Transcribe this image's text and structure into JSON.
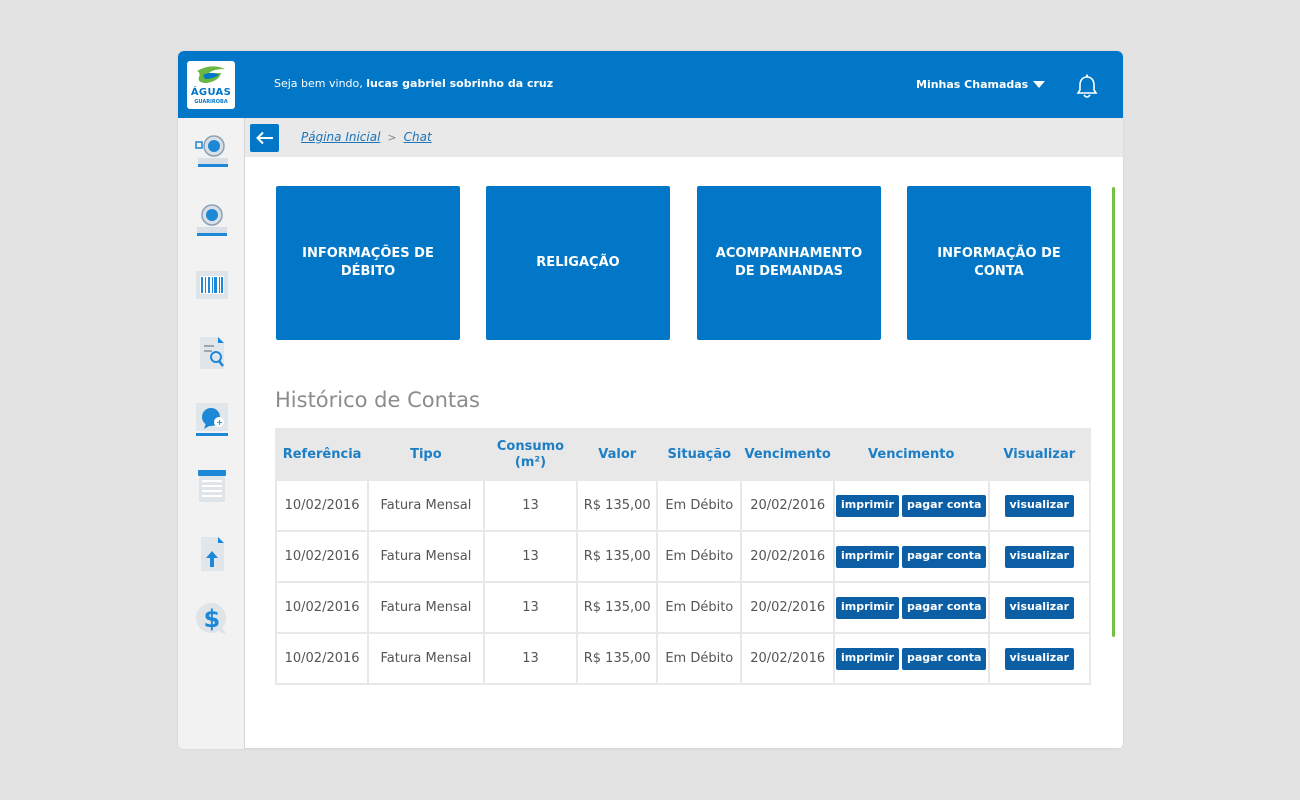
{
  "header": {
    "logo_line1": "ÁGUAS",
    "logo_line2": "GUARIROBA",
    "welcome_prefix": "Seja bem vindo, ",
    "user_name": "lucas gabriel sobrinho da cruz",
    "calls_label": "Minhas Chamadas",
    "bell_icon": "bell-icon"
  },
  "sidebar": {
    "icons": [
      "water-meter-icon",
      "water-meter-alt-icon",
      "barcode-icon",
      "document-search-icon",
      "chat-support-icon",
      "bill-list-icon",
      "upload-document-icon",
      "payment-dollar-icon"
    ]
  },
  "breadcrumb": {
    "home": "Página Inicial",
    "separator": ">",
    "current": "Chat"
  },
  "tiles": [
    "INFORMAÇÕES DE DÉBITO",
    "RELIGAÇÃO",
    "ACOMPANHAMENTO DE DEMANDAS",
    "INFORMAÇÃO DE CONTA"
  ],
  "history": {
    "title": "Histórico de Contas",
    "columns": [
      "Referência",
      "Tipo",
      "Consumo (m²)",
      "Valor",
      "Situação",
      "Vencimento",
      "Vencimento",
      "Visualizar"
    ],
    "rows": [
      {
        "referencia": "10/02/2016",
        "tipo": "Fatura Mensal",
        "consumo": "13",
        "valor": "R$ 135,00",
        "situacao": "Em Débito",
        "vencimento": "20/02/2016"
      },
      {
        "referencia": "10/02/2016",
        "tipo": "Fatura Mensal",
        "consumo": "13",
        "valor": "R$ 135,00",
        "situacao": "Em Débito",
        "vencimento": "20/02/2016"
      },
      {
        "referencia": "10/02/2016",
        "tipo": "Fatura Mensal",
        "consumo": "13",
        "valor": "R$ 135,00",
        "situacao": "Em Débito",
        "vencimento": "20/02/2016"
      },
      {
        "referencia": "10/02/2016",
        "tipo": "Fatura Mensal",
        "consumo": "13",
        "valor": "R$ 135,00",
        "situacao": "Em Débito",
        "vencimento": "20/02/2016"
      }
    ],
    "print_label": "imprimir",
    "pay_label": "pagar conta",
    "view_label": "visualizar"
  },
  "colors": {
    "primary": "#0277c7",
    "button": "#0c5fa5",
    "header_text": "#1c7ec5",
    "scroll": "#76c043",
    "background": "#e3e3e3"
  }
}
